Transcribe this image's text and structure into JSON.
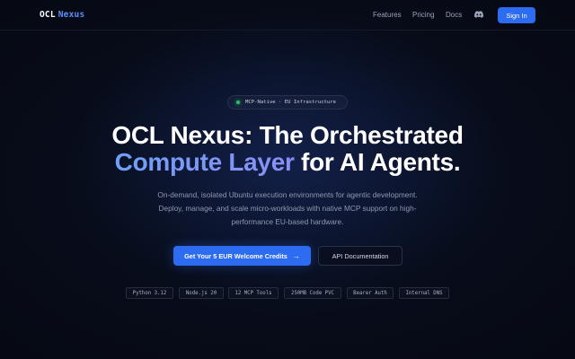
{
  "nav": {
    "logo_primary": "OCL",
    "logo_accent": "Nexus",
    "links": [
      "Features",
      "Pricing",
      "Docs"
    ],
    "discord_icon": "discord-icon",
    "signin_label": "Sign In"
  },
  "hero": {
    "badge": "MCP-Native · EU Infrastructure",
    "headline_line1": "OCL Nexus: The Orchestrated",
    "headline_accent": "Compute Layer",
    "headline_rest": " for AI Agents.",
    "subtitle_line1": "On-demand, isolated Ubuntu execution environments for agentic development.",
    "subtitle_line2": "Deploy, manage, and scale micro-workloads with native MCP support on high-",
    "subtitle_line3": "performance EU-based hardware.",
    "cta_primary": "Get Your 5 EUR Welcome Credits",
    "cta_primary_icon": "arrow-right-icon",
    "cta_secondary": "API Documentation"
  },
  "tech_chips": [
    "Python 3.12",
    "Node.js 20",
    "12 MCP Tools",
    "250MB Code PVC",
    "Bearer Auth",
    "Internal DNS"
  ],
  "colors": {
    "accent": "#2d6cf0",
    "gradient_start": "#6fa0f8",
    "gradient_end": "#8a8ff5",
    "status_dot": "#22c55e",
    "background": "#05070f"
  }
}
